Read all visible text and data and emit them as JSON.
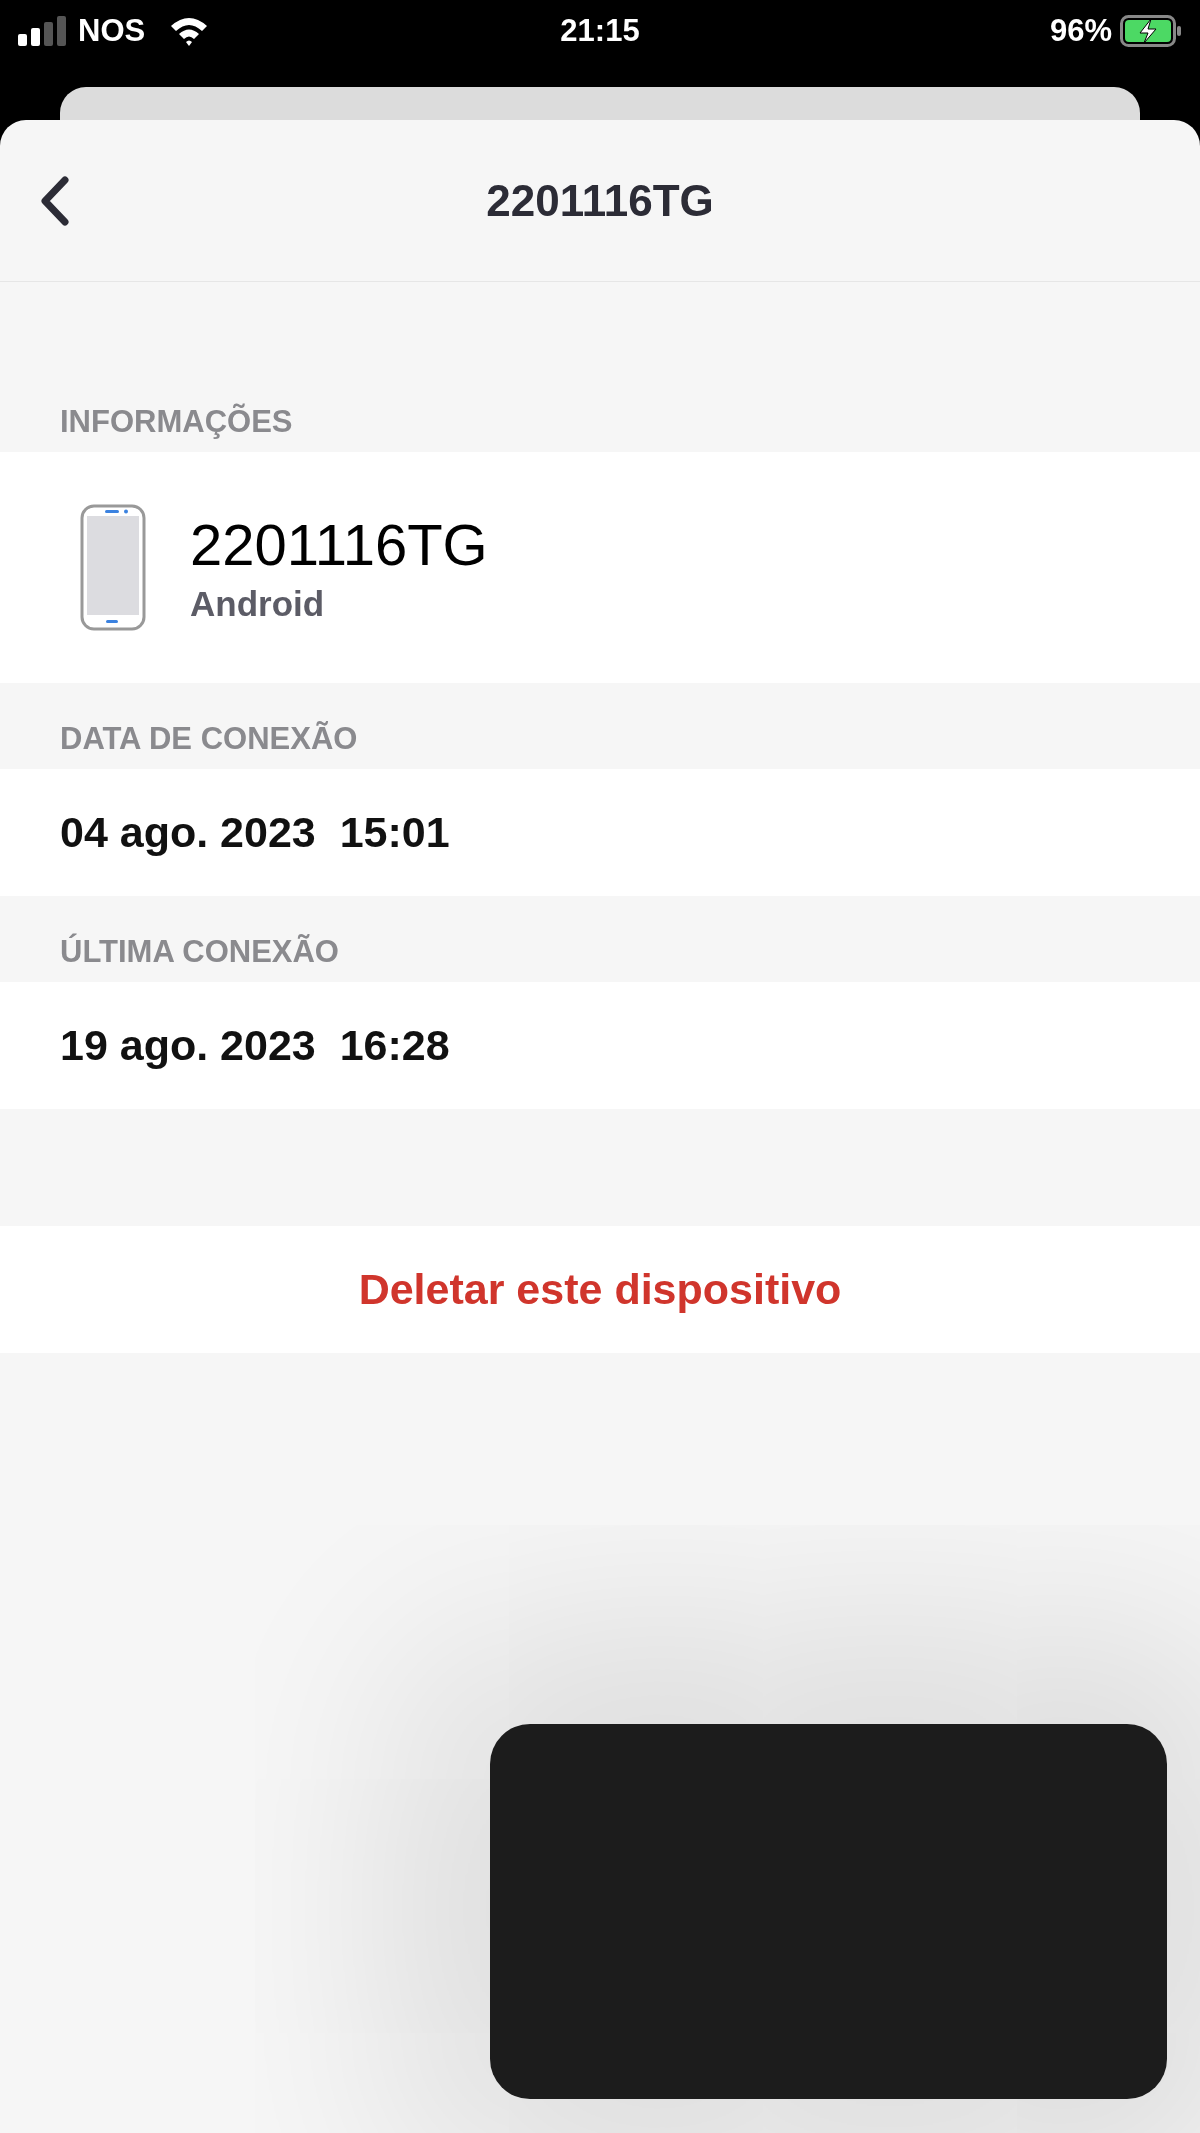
{
  "status_bar": {
    "carrier": "NOS",
    "time": "21:15",
    "battery": "96%"
  },
  "header": {
    "title": "2201116TG"
  },
  "sections": [
    {
      "kind": "device",
      "label": "INFORMAÇÕES",
      "name": "2201116TG",
      "platform": "Android"
    },
    {
      "kind": "value",
      "label": "DATA DE CONEXÃO",
      "value": "04 ago. 2023  15:01"
    },
    {
      "kind": "value",
      "label": "ÚLTIMA CONEXÃO",
      "value": "19 ago. 2023  16:28"
    }
  ],
  "delete_button": "Deletar este dispositivo"
}
